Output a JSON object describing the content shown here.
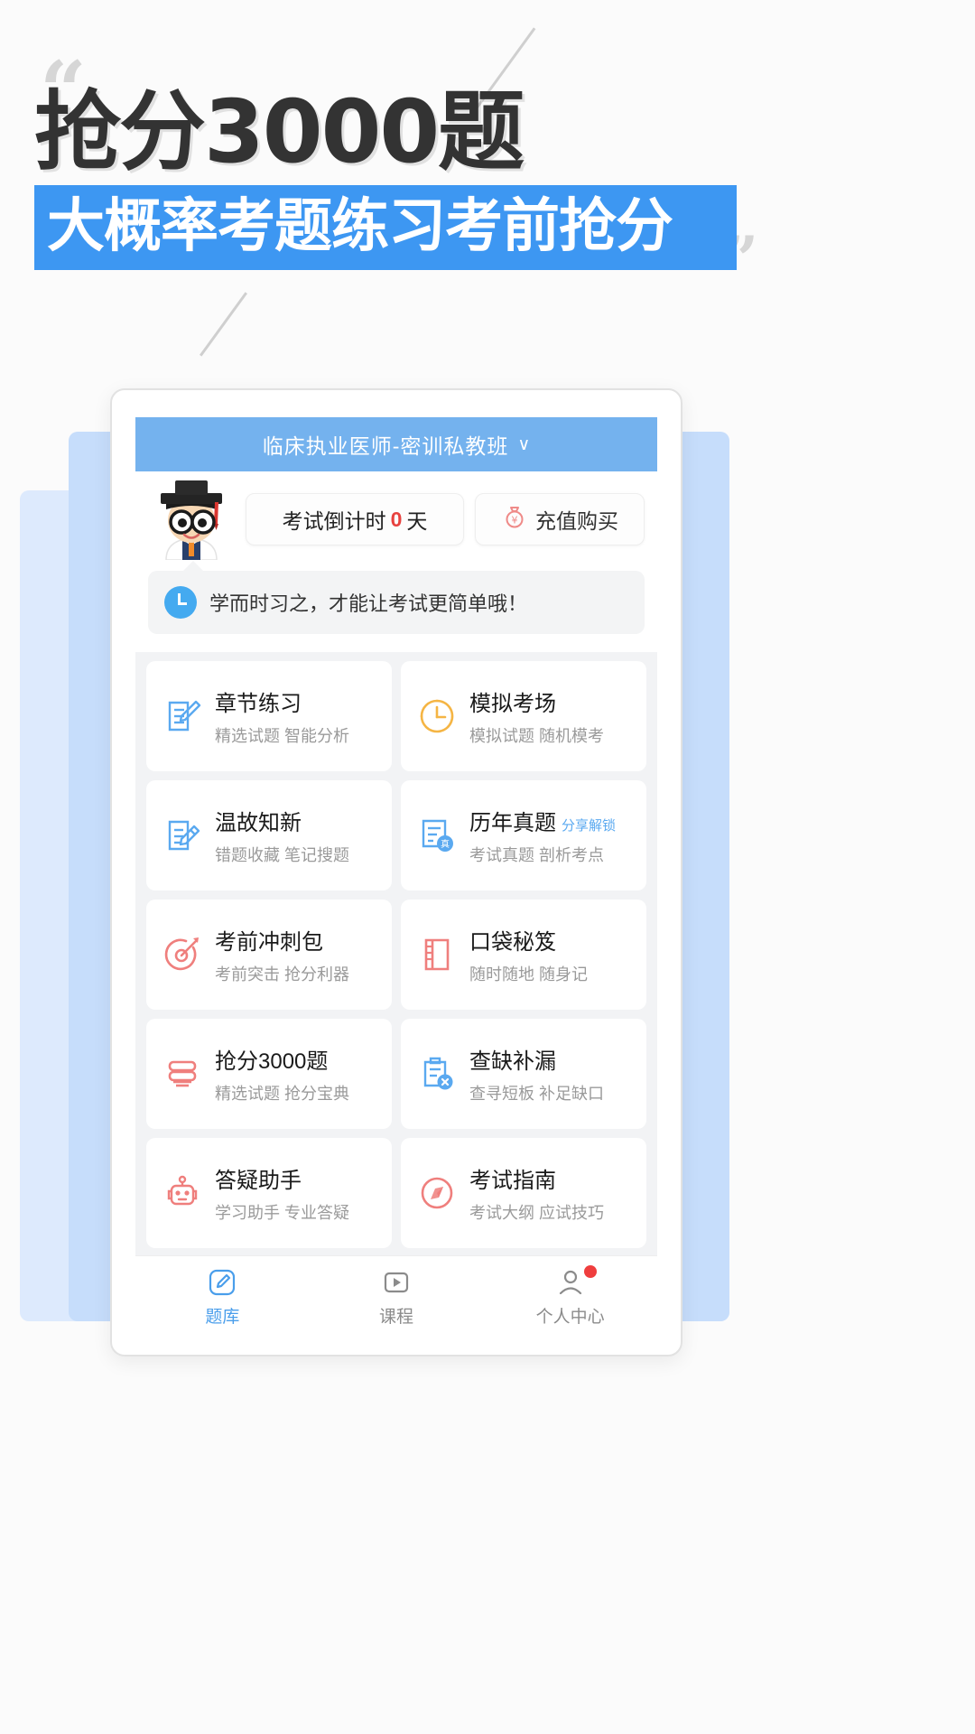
{
  "poster": {
    "quote_open": "“",
    "quote_close": "”",
    "headline": "抢分3000题",
    "subline": "大概率考题练习考前抢分",
    "accent_blue": "#3d97f2",
    "headline_color": "#333333"
  },
  "app": {
    "header": {
      "title": "临床执业医师-密训私教班",
      "chevron": "∨",
      "bg": "#74b2ee"
    },
    "countdown": {
      "prefix": "考试倒计时",
      "days": "0",
      "suffix": "天",
      "days_color": "#e8423f"
    },
    "recharge": {
      "label": "充值购买",
      "icon": "money-bag-icon",
      "color": "#ef8a88"
    },
    "tip": {
      "icon": "clock-icon",
      "text": "学而时习之，才能让考试更简单哦！"
    },
    "grid": [
      {
        "title": "章节练习",
        "subtitle": "精选试题 智能分析",
        "badge": "",
        "icon": "document-edit-icon",
        "color": "#5aa9f0"
      },
      {
        "title": "模拟考场",
        "subtitle": "模拟试题 随机模考",
        "badge": "",
        "icon": "clock-outline-icon",
        "color": "#f5b544"
      },
      {
        "title": "温故知新",
        "subtitle": "错题收藏 笔记搜题",
        "badge": "",
        "icon": "note-pencil-icon",
        "color": "#5aa9f0"
      },
      {
        "title": "历年真题",
        "subtitle": "考试真题 剖析考点",
        "badge": "分享解锁",
        "icon": "paper-stamp-icon",
        "color": "#5aa9f0"
      },
      {
        "title": "考前冲刺包",
        "subtitle": "考前突击 抢分利器",
        "badge": "",
        "icon": "target-dart-icon",
        "color": "#ef7f7d"
      },
      {
        "title": "口袋秘笈",
        "subtitle": "随时随地 随身记",
        "badge": "",
        "icon": "notebook-icon",
        "color": "#ef7f7d"
      },
      {
        "title": "抢分3000题",
        "subtitle": "精选试题 抢分宝典",
        "badge": "",
        "icon": "stacked-books-icon",
        "color": "#ef7f7d"
      },
      {
        "title": "查缺补漏",
        "subtitle": "查寻短板 补足缺口",
        "badge": "",
        "icon": "clipboard-x-icon",
        "color": "#5aa9f0"
      },
      {
        "title": "答疑助手",
        "subtitle": "学习助手 专业答疑",
        "badge": "",
        "icon": "robot-icon",
        "color": "#ef7f7d"
      },
      {
        "title": "考试指南",
        "subtitle": "考试大纲 应试技巧",
        "badge": "",
        "icon": "compass-icon",
        "color": "#ef7f7d"
      }
    ],
    "tabs": [
      {
        "label": "题库",
        "icon": "pencil-square-icon",
        "active": true,
        "dot": false
      },
      {
        "label": "课程",
        "icon": "play-square-icon",
        "active": false,
        "dot": false
      },
      {
        "label": "个人中心",
        "icon": "person-icon",
        "active": false,
        "dot": true
      }
    ]
  }
}
